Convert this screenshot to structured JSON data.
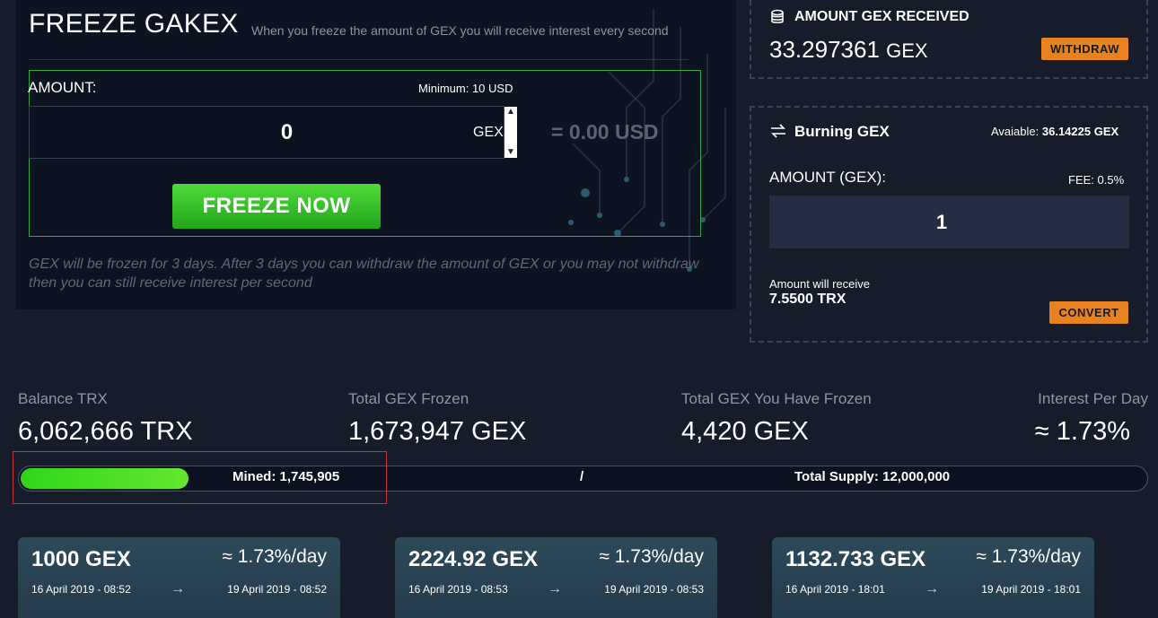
{
  "freeze": {
    "title": "FREEZE GAKEX",
    "subtitle": "When you freeze the amount of GEX you will receive interest every second",
    "amount_label": "AMOUNT:",
    "minimum": "Minimum: 10 USD",
    "amount_value": "0",
    "unit": "GEX",
    "usd_equivalent": "= 0.00 USD",
    "button": "FREEZE NOW",
    "note": "GEX will be frozen for 3 days. After 3 days you can withdraw the amount of GEX or you may not withdraw then you can still receive interest per second"
  },
  "received": {
    "title": "AMOUNT GEX RECEIVED",
    "value": "33.297361",
    "unit": "GEX",
    "button": "WITHDRAW"
  },
  "burning": {
    "title": "Burning GEX",
    "available_label": "Avaiable:",
    "available_value": "36.14225 GEX",
    "amount_label": "AMOUNT (GEX):",
    "fee": "FEE: 0.5%",
    "amount_value": "1",
    "receive_label": "Amount will receive",
    "receive_value": "7.5500 TRX",
    "button": "CONVERT"
  },
  "stats": [
    {
      "label": "Balance TRX",
      "value": "6,062,666 TRX"
    },
    {
      "label": "Total GEX Frozen",
      "value": "1,673,947 GEX"
    },
    {
      "label": "Total GEX You Have Frozen",
      "value": "4,420 GEX"
    },
    {
      "label": "Interest Per Day",
      "value": "≈ 1.73%"
    }
  ],
  "progress": {
    "mined_label": "Mined: 1,745,905",
    "separator": "/",
    "supply_label": "Total Supply: 12,000,000",
    "fraction": 0.1455
  },
  "cards": [
    {
      "amount": "1000 GEX",
      "rate": "≈ 1.73%/day",
      "start": "16 April 2019 - 08:52",
      "end": "19 April 2019 - 08:52"
    },
    {
      "amount": "2224.92 GEX",
      "rate": "≈ 1.73%/day",
      "start": "16 April 2019 - 08:53",
      "end": "19 April 2019 - 08:53"
    },
    {
      "amount": "1132.733 GEX",
      "rate": "≈ 1.73%/day",
      "start": "16 April 2019 - 18:01",
      "end": "19 April 2019 - 18:01"
    }
  ],
  "icons": {
    "received": "coins-icon",
    "burning": "swap-arrows-icon",
    "card_arrow": "arrow-right-icon"
  },
  "colors": {
    "accent_green": "#2fd61a",
    "button_orange": "#e8811f",
    "background": "#161c2a"
  }
}
